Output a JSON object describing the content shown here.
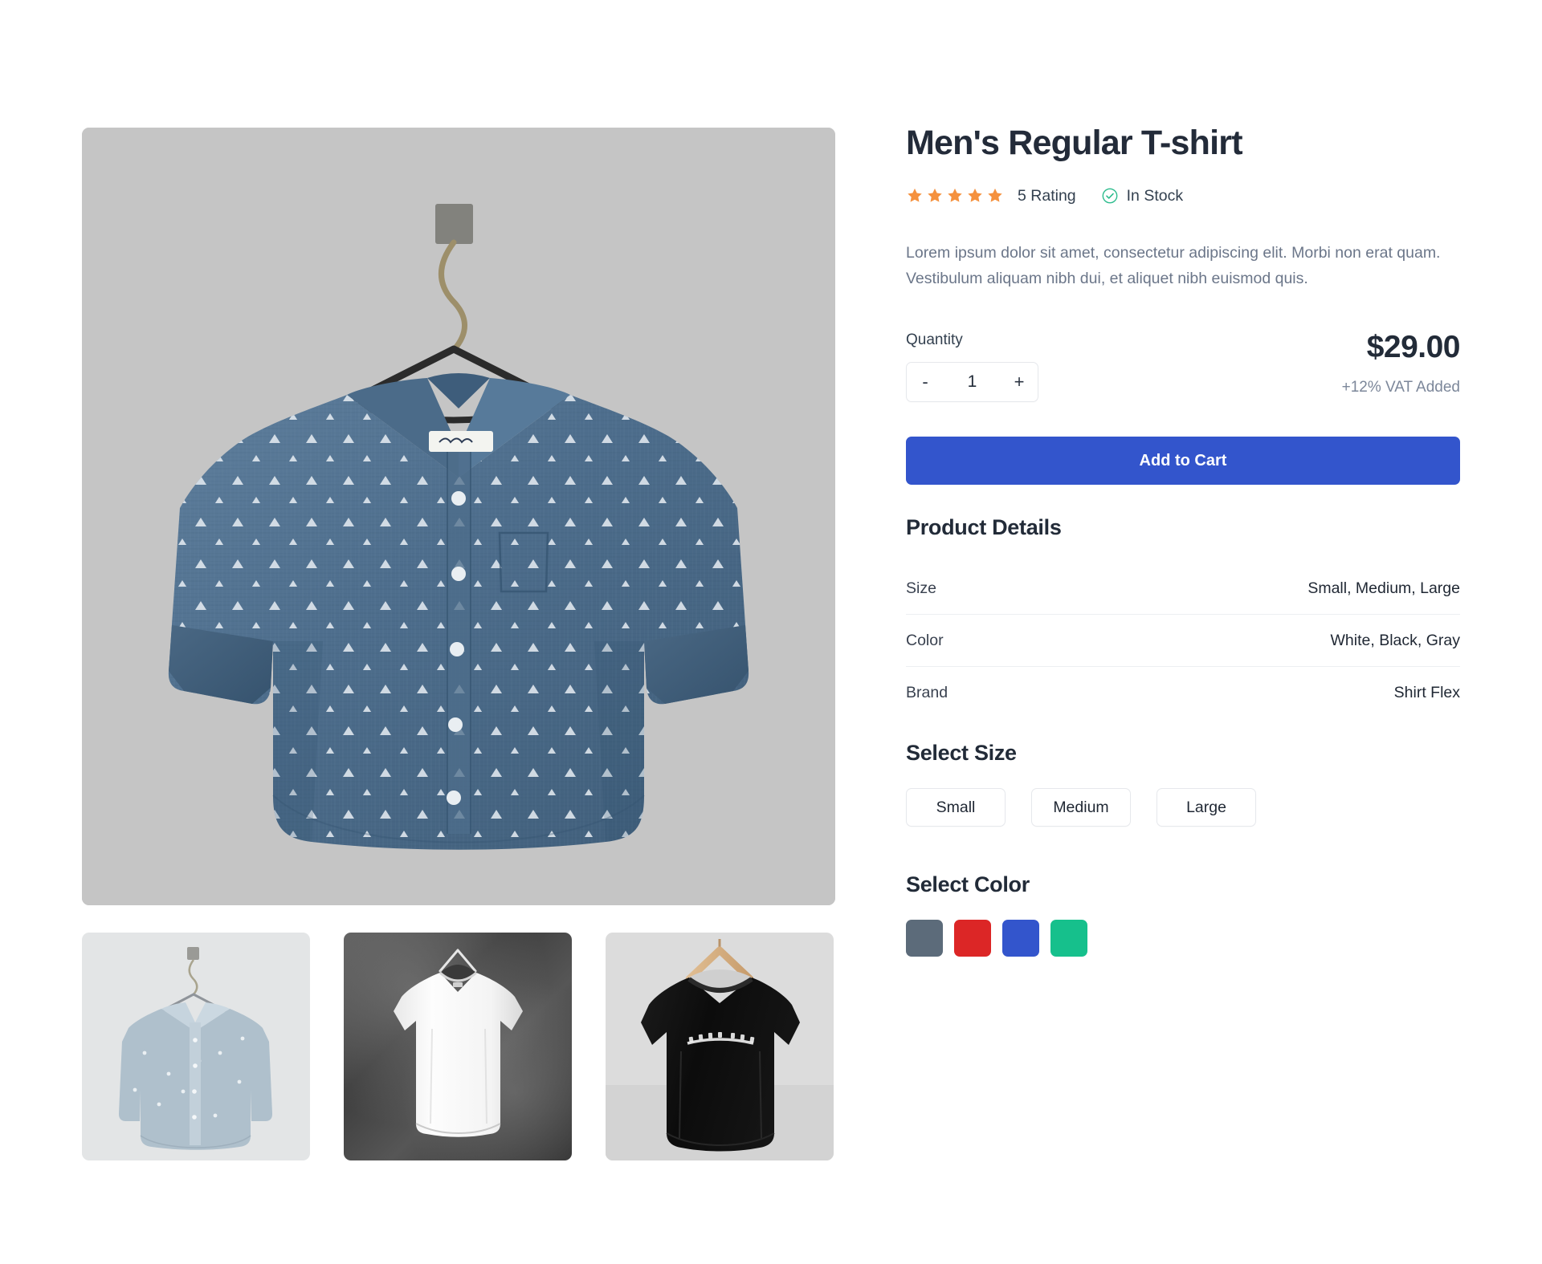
{
  "product": {
    "title": "Men's Regular T-shirt",
    "rating_value": 5,
    "rating_label": "5 Rating",
    "stock_label": "In Stock",
    "stock_icon": "check-circle-icon",
    "star_icon": "star-icon",
    "description": "Lorem ipsum dolor sit amet, consectetur adipiscing elit. Morbi non erat quam. Vestibulum aliquam nibh dui, et aliquet nibh euismod quis.",
    "price": "$29.00",
    "vat_note": "+12% VAT Added"
  },
  "quantity": {
    "label": "Quantity",
    "value": "1",
    "decrement_label": "-",
    "increment_label": "+"
  },
  "actions": {
    "add_to_cart": "Add to Cart"
  },
  "product_details": {
    "heading": "Product Details",
    "rows": [
      {
        "key": "Size",
        "value": "Small, Medium, Large"
      },
      {
        "key": "Color",
        "value": "White, Black, Gray"
      },
      {
        "key": "Brand",
        "value": "Shirt Flex"
      }
    ]
  },
  "select_size": {
    "heading": "Select Size",
    "options": [
      "Small",
      "Medium",
      "Large"
    ]
  },
  "select_color": {
    "heading": "Select Color",
    "options": [
      {
        "name": "Slate Gray",
        "hex": "#5c6b7a"
      },
      {
        "name": "Red",
        "hex": "#dc2626"
      },
      {
        "name": "Blue",
        "hex": "#3355cc"
      },
      {
        "name": "Green",
        "hex": "#16c08c"
      }
    ]
  },
  "gallery": {
    "main_image_alt": "Blue chambray patterned button-up shirt on hanger",
    "main_bg": "#c5c5c5",
    "thumbnails": [
      {
        "alt": "Light chambray shirt on hanger",
        "bg": "#e3e5e6"
      },
      {
        "alt": "White t-shirt on dark concrete background",
        "bg": "#4a4a4a"
      },
      {
        "alt": "Black t-shirt with text print on wooden hanger",
        "bg": "#dcdcdc"
      }
    ]
  },
  "theme": {
    "accent": "#3355cc",
    "star_color": "#f5913e",
    "success": "#2bbb8c",
    "title_color": "#232b39",
    "muted_text": "#6b7689"
  }
}
